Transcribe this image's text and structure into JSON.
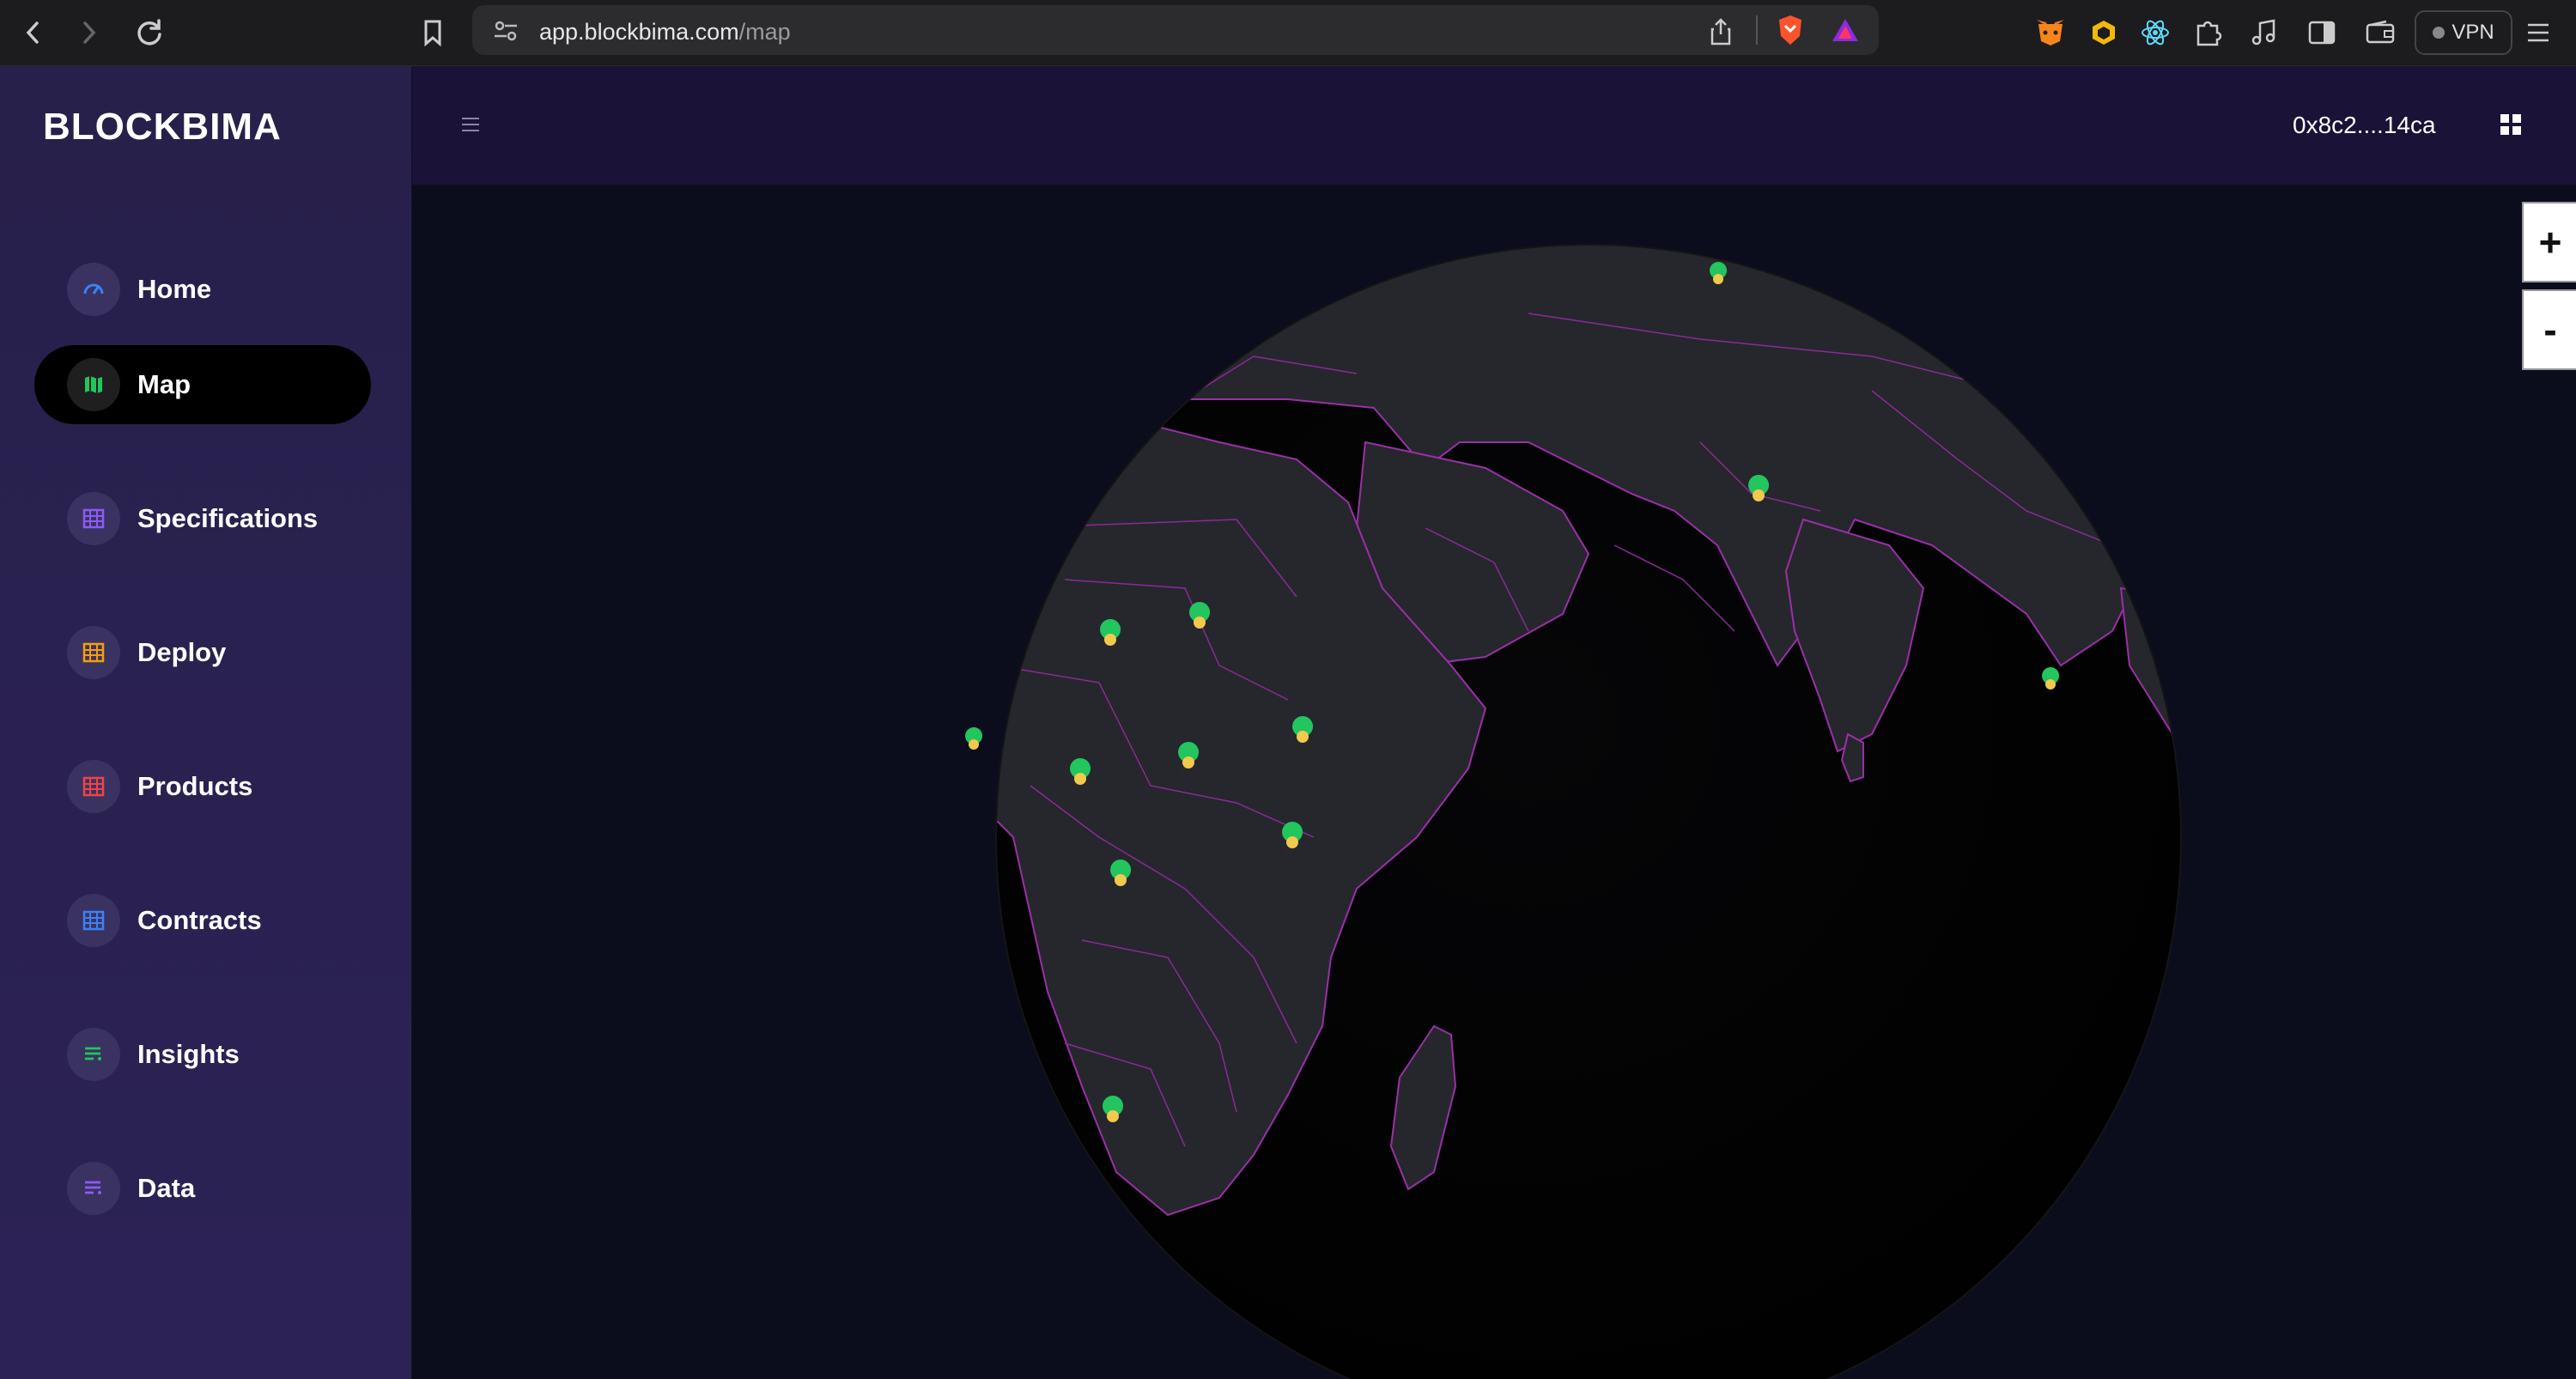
{
  "browser": {
    "url_domain": "app.blockbima.com",
    "url_path": "/map",
    "vpn_label": "VPN"
  },
  "app": {
    "logo": "BLOCKBIMA",
    "wallet_address": "0x8c2....14ca"
  },
  "sidebar": {
    "items": [
      {
        "label": "Home",
        "icon": "speedometer-icon",
        "color": "#3b82f6"
      },
      {
        "label": "Map",
        "icon": "map-icon",
        "color": "#22c55e",
        "active": true
      },
      {
        "label": "Specifications",
        "icon": "table-icon",
        "color": "#8b5cf6"
      },
      {
        "label": "Deploy",
        "icon": "table-icon",
        "color": "#f59e0b"
      },
      {
        "label": "Products",
        "icon": "table-icon",
        "color": "#ef4444"
      },
      {
        "label": "Contracts",
        "icon": "table-icon",
        "color": "#3b82f6"
      },
      {
        "label": "Insights",
        "icon": "list-icon",
        "color": "#22c55e"
      },
      {
        "label": "Data",
        "icon": "list-icon",
        "color": "#8b5cf6"
      }
    ]
  },
  "map": {
    "zoom_in_label": "+",
    "zoom_out_label": "-",
    "marker_color": "#22c55e"
  }
}
